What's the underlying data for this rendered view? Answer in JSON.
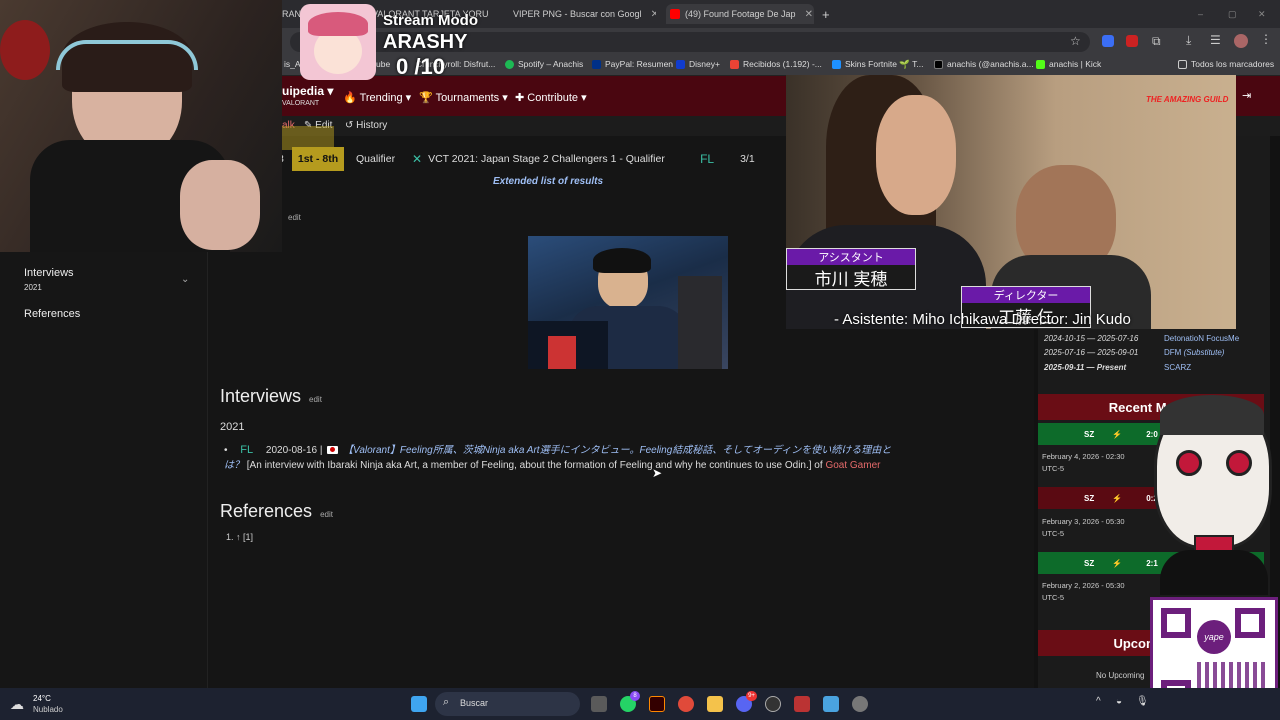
{
  "browser": {
    "tabs": [
      {
        "title": "RANT",
        "color": "#e24"
      },
      {
        "title": "VALORANT TARJETA YORU",
        "color": "#e24"
      },
      {
        "title": "VIPER PNG - Buscar con Googl",
        "color": "#4285f4"
      },
      {
        "title": "(49) Found Footage De Jap",
        "color": "#f00"
      }
    ],
    "new_tab": "+",
    "window_controls": {
      "min": "–",
      "max": "▢",
      "close": "✕"
    },
    "bookmarks": [
      {
        "label": "is_AP",
        "color": "#888"
      },
      {
        "label": "ube",
        "color": "#f00"
      },
      {
        "label": "Crunchyroll: Disfrut...",
        "color": "#f47521"
      },
      {
        "label": "Spotify – Anachis",
        "color": "#1db954"
      },
      {
        "label": "PayPal: Resumen",
        "color": "#003087"
      },
      {
        "label": "Disney+",
        "color": "#113ccf"
      },
      {
        "label": "Recibidos (1.192) -...",
        "color": "#ea4335"
      },
      {
        "label": "Skins Fortnite 🌱 T...",
        "color": "#1e90ff"
      },
      {
        "label": "anachis (@anachis.a...",
        "color": "#000"
      },
      {
        "label": "anachis | Kick",
        "color": "#53fc18"
      }
    ],
    "all_bookmarks": "Todos los marcadores"
  },
  "stream_overlay": {
    "title": "Stream Modo",
    "name": "ARASHY",
    "score": "0 /10"
  },
  "liquipedia": {
    "logo": "uipedia",
    "logo_sub": "VALORANT",
    "nav": [
      "Trending",
      "Tournaments",
      "Contribute"
    ],
    "sub_nav": [
      "alk",
      "Edit",
      "History"
    ],
    "tools": "ols"
  },
  "results": {
    "rows": [
      {
        "num": "3",
        "place": "1st - 8th",
        "tier": "Qualifier",
        "tournament": "VCT 2021: Japan Stage 2 Challengers 1 - Qualifier",
        "score": "3/1"
      }
    ],
    "extended_link": "Extended list of results",
    "edit": "edit"
  },
  "sidebar": {
    "items": [
      {
        "label": "Interviews",
        "sub": "2021"
      },
      {
        "label": "References",
        "sub": ""
      }
    ]
  },
  "interviews": {
    "heading": "Interviews",
    "edit": "edit",
    "year": "2021",
    "entry": {
      "date": "2020-08-16 |",
      "title_jp": "【Valorant】Feeling所属、茨城Ninja aka Art選手にインタビュー。Feeling結成秘話、そしてオーディンを使い続ける理由とは？",
      "translation": "[An interview with Ibaraki Ninja aka Art, a member of Feeling, about the formation of Feeling and why he continues to use Odin.] of",
      "source": "Goat Gamer"
    }
  },
  "references": {
    "heading": "References",
    "edit": "edit",
    "item": "1. ↑ [1]"
  },
  "team_history": [
    {
      "dates": "2024-10-15 — 2025-07-16",
      "team": "DetonatioN FocusMe"
    },
    {
      "dates": "2025-07-16 — 2025-09-01",
      "team": "DFM",
      "note": "(Substitute)"
    },
    {
      "dates": "2025-09-11 — Present",
      "team": "SCARZ"
    }
  ],
  "recent_matches": {
    "heading": "Recent Match",
    "matches": [
      {
        "team": "SZ",
        "score": "2:0",
        "bo": "(Bo3)",
        "date": "February 4, 2026 - 02:30",
        "tz": "UTC-5",
        "color": "#0d6b2a"
      },
      {
        "team": "SZ",
        "score": "0:2",
        "bo": "(Bo3)",
        "date": "February 3, 2026 - 05:30",
        "tz": "UTC-5",
        "color": "#5a0a12"
      },
      {
        "team": "SZ",
        "score": "2:1",
        "bo": "(Bo3)",
        "date": "February 2, 2026 - 05:30",
        "tz": "UTC-5",
        "color": "#0d6b2a"
      }
    ],
    "upcoming_heading": "Upcoming T",
    "no_upcoming": "No Upcoming"
  },
  "video": {
    "watermark": "THE AMAZING GUILD",
    "label1_title": "アシスタント",
    "label1_name": "市川 実穂",
    "label2_title": "ディレクター",
    "label2_name": "工藤 仁",
    "subtitle": "- Asistente: Miho Ichikawa Director: Jin Kudo"
  },
  "taskbar": {
    "weather_temp": "24°C",
    "weather_desc": "Nublado",
    "search_placeholder": "Buscar",
    "badges": {
      "whatsapp": "8",
      "discord": "9+"
    }
  },
  "qr": {
    "brand": "yape"
  }
}
